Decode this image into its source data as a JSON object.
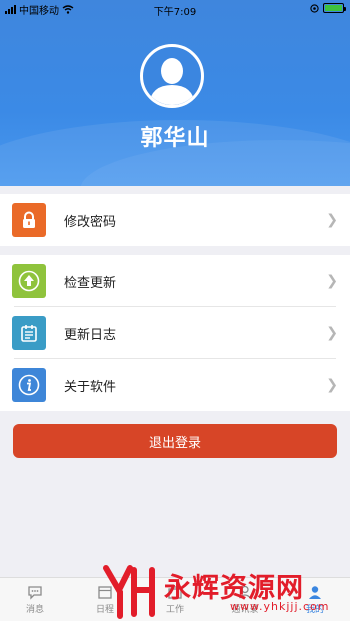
{
  "status_bar": {
    "carrier": "中国移动",
    "time": "下午7:09"
  },
  "profile": {
    "name": "郭华山"
  },
  "menu": {
    "change_password": "修改密码",
    "check_update": "检查更新",
    "update_log": "更新日志",
    "about": "关于软件"
  },
  "logout_label": "退出登录",
  "tabs": [
    "消息",
    "日程",
    "工作",
    "通讯录",
    "我的"
  ],
  "watermark": {
    "text": "永辉资源网",
    "url": "www.yhkjjj.com"
  },
  "colors": {
    "header": "#3b86e0",
    "lock_icon_bg": "#ea6a28",
    "update_icon_bg": "#8fc33c",
    "log_icon_bg": "#3a9cc6",
    "about_icon_bg": "#3e86d8",
    "logout": "#d74527"
  },
  "icons": [
    "signal-icon",
    "wifi-icon",
    "battery-icon",
    "avatar-icon",
    "lock-icon",
    "upload-icon",
    "calendar-list-icon",
    "info-icon",
    "chevron-right-icon",
    "message-icon",
    "calendar-icon",
    "briefcase-icon",
    "contacts-icon",
    "user-icon"
  ]
}
